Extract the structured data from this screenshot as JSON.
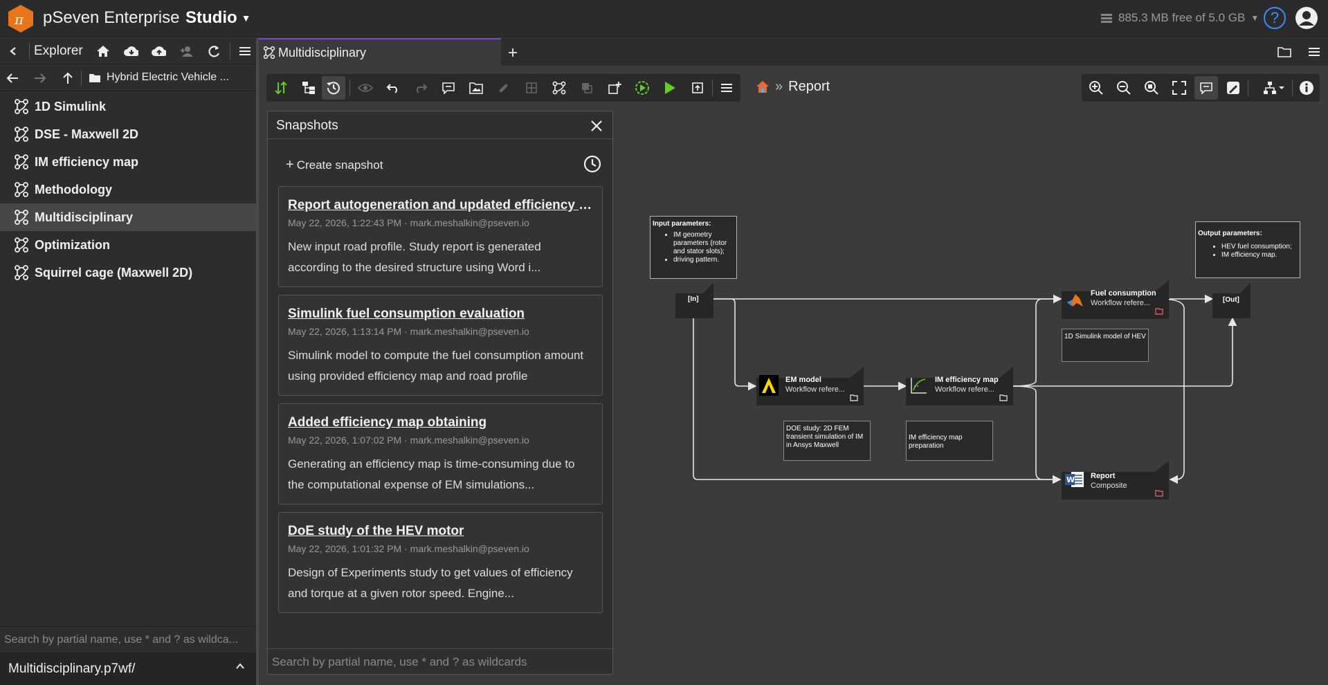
{
  "app": {
    "brand": "pSeven Enterprise",
    "studio": "Studio",
    "storage": "885.3 MB free of 5.0 GB",
    "help": "?"
  },
  "explorer": {
    "title": "Explorer",
    "path": "Hybrid Electric Vehicle ...",
    "items": [
      {
        "label": "1D Simulink"
      },
      {
        "label": "DSE - Maxwell 2D"
      },
      {
        "label": "IM efficiency map"
      },
      {
        "label": "Methodology"
      },
      {
        "label": "Multidisciplinary"
      },
      {
        "label": "Optimization"
      },
      {
        "label": "Squirrel cage (Maxwell 2D)"
      }
    ],
    "selected_index": 4,
    "search_placeholder": "Search by partial name, use * and ? as wildca...",
    "footer": "Multidisciplinary.p7wf/"
  },
  "tabs": [
    {
      "label": "Multidisciplinary"
    }
  ],
  "breadcrumb": {
    "sep": "»",
    "current": "Report"
  },
  "snapshots": {
    "title": "Snapshots",
    "create": "Create snapshot",
    "search_placeholder": "Search by partial name, use * and ? as wildcards",
    "items": [
      {
        "title": "Report autogeneration and updated efficiency map obtaining",
        "meta": "May 22, 2026, 1:22:43 PM · mark.meshalkin@pseven.io",
        "desc1": "New input road profile. Study report is generated",
        "desc2": "according to the desired structure using Word i..."
      },
      {
        "title": "Simulink fuel consumption evaluation",
        "meta": "May 22, 2026, 1:13:14 PM · mark.meshalkin@pseven.io",
        "desc1": "Simulink model to compute the fuel consumption amount",
        "desc2": "using provided efficiency map and road profile"
      },
      {
        "title": "Added efficiency map obtaining",
        "meta": "May 22, 2026, 1:07:02 PM · mark.meshalkin@pseven.io",
        "desc1": "Generating an efficiency map is time-consuming due to",
        "desc2": "the computational expense of EM simulations..."
      },
      {
        "title": "DoE study of the HEV motor",
        "meta": "May 22, 2026, 1:01:32 PM · mark.meshalkin@pseven.io",
        "desc1": "Design of Experiments study to get values of efficiency",
        "desc2": "and torque at a given rotor speed. Engine..."
      }
    ]
  },
  "workflow": {
    "input_box": {
      "title": "Input parameters:",
      "b1": "IM geometry parameters (rotor and stator slots);",
      "b2": "driving pattern."
    },
    "output_box": {
      "title": "Output parameters:",
      "b1": "HEV fuel consumption;",
      "b2": "IM efficiency map."
    },
    "in_label": "[In]",
    "out_label": "[Out]",
    "fuel": {
      "title": "Fuel consumption",
      "sub": "Workflow refere..."
    },
    "em": {
      "title": "EM model",
      "sub": "Workflow refere..."
    },
    "im": {
      "title": "IM efficiency map",
      "sub": "Workflow refere..."
    },
    "report": {
      "title": "Report",
      "sub": "Composite"
    },
    "notes": {
      "simulink": "1D Simulink model of HEV",
      "doe": "DOE study: 2D FEM transient simulation of IM in Ansys Maxwell",
      "immap": "IM efficiency map preparation"
    }
  },
  "colors": {
    "accent": "#7b3fe4",
    "run": "#5fd11e",
    "help": "#3d8cff",
    "logo": "#e8751a"
  }
}
